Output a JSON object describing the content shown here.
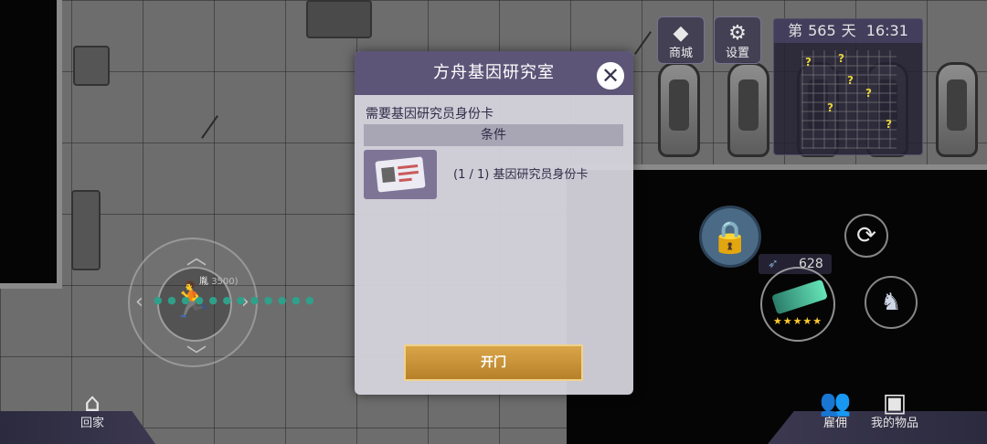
{
  "hud": {
    "shop": {
      "label": "商城",
      "icon": "diamond-icon",
      "glyph": "◆"
    },
    "settings": {
      "label": "设置",
      "icon": "gear-icon",
      "glyph": "⚙"
    },
    "day_prefix": "第",
    "day_number": "565",
    "day_suffix": "天",
    "clock": "16:31"
  },
  "dialog": {
    "title": "方舟基因研究室",
    "close_glyph": "✕",
    "requirement": "需要基因研究员身份卡",
    "conditions_header": "条件",
    "condition_text": "(1 / 1) 基因研究员身份卡",
    "open_button": "开门"
  },
  "player": {
    "name_tag": "胤 ",
    "name_tag_suffix": "3500)"
  },
  "controls": {
    "lock_glyph": "🔒",
    "swap_glyph": "⟳",
    "ammo_count": "628",
    "weapon_stars": 5,
    "skill_glyph": "♞",
    "run_glyph": "🏃"
  },
  "bottom": {
    "home": {
      "label": "回家",
      "glyph": "⌂"
    },
    "hire": {
      "label": "雇佣",
      "glyph": "👥"
    },
    "items": {
      "label": "我的物品",
      "glyph": "▣"
    }
  },
  "colors": {
    "dialog_header": "#5d5577",
    "open_button": "#c8923a",
    "lock_button": "#4a6a86",
    "star": "#ffc931"
  }
}
